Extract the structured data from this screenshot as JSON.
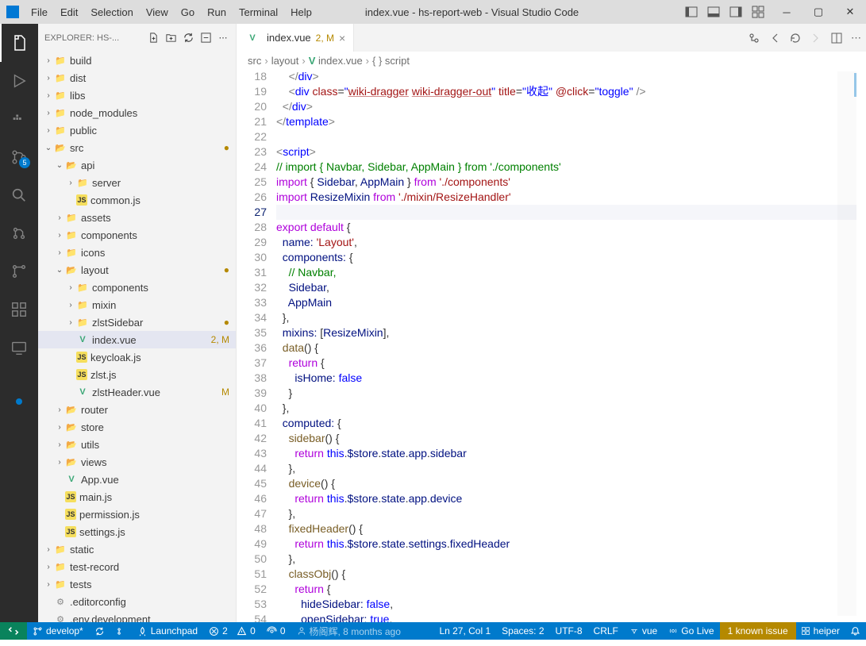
{
  "titlebar": {
    "menu": [
      "File",
      "Edit",
      "Selection",
      "View",
      "Go",
      "Run",
      "Terminal",
      "Help"
    ],
    "title": "index.vue - hs-report-web - Visual Studio Code"
  },
  "sidebar": {
    "header": "EXPLORER: HS-...",
    "tree": [
      {
        "indent": 0,
        "chev": "›",
        "icon": "folder-g",
        "name": "build"
      },
      {
        "indent": 0,
        "chev": "›",
        "icon": "folder-g",
        "name": "dist"
      },
      {
        "indent": 0,
        "chev": "›",
        "icon": "folder-g",
        "name": "libs"
      },
      {
        "indent": 0,
        "chev": "›",
        "icon": "folder-g",
        "name": "node_modules"
      },
      {
        "indent": 0,
        "chev": "›",
        "icon": "folder-g",
        "name": "public"
      },
      {
        "indent": 0,
        "chev": "⌄",
        "icon": "folder-o",
        "name": "src",
        "mod": "●"
      },
      {
        "indent": 1,
        "chev": "⌄",
        "icon": "folder-o",
        "name": "api"
      },
      {
        "indent": 2,
        "chev": "›",
        "icon": "folder-g",
        "name": "server"
      },
      {
        "indent": 2,
        "chev": "",
        "icon": "js",
        "name": "common.js"
      },
      {
        "indent": 1,
        "chev": "›",
        "icon": "folder-g",
        "name": "assets"
      },
      {
        "indent": 1,
        "chev": "›",
        "icon": "folder-g",
        "name": "components"
      },
      {
        "indent": 1,
        "chev": "›",
        "icon": "folder-g",
        "name": "icons"
      },
      {
        "indent": 1,
        "chev": "⌄",
        "icon": "folder-o",
        "name": "layout",
        "mod": "●"
      },
      {
        "indent": 2,
        "chev": "›",
        "icon": "folder-g",
        "name": "components"
      },
      {
        "indent": 2,
        "chev": "›",
        "icon": "folder-g",
        "name": "mixin"
      },
      {
        "indent": 2,
        "chev": "›",
        "icon": "folder-g",
        "name": "zlstSidebar",
        "mod": "●"
      },
      {
        "indent": 2,
        "chev": "",
        "icon": "vue",
        "name": "index.vue",
        "mod": "2, M",
        "selected": true
      },
      {
        "indent": 2,
        "chev": "",
        "icon": "js",
        "name": "keycloak.js"
      },
      {
        "indent": 2,
        "chev": "",
        "icon": "js",
        "name": "zlst.js"
      },
      {
        "indent": 2,
        "chev": "",
        "icon": "vue",
        "name": "zlstHeader.vue",
        "mod": "M"
      },
      {
        "indent": 1,
        "chev": "›",
        "icon": "folder-o",
        "name": "router"
      },
      {
        "indent": 1,
        "chev": "›",
        "icon": "folder-o",
        "name": "store"
      },
      {
        "indent": 1,
        "chev": "›",
        "icon": "folder-o",
        "name": "utils"
      },
      {
        "indent": 1,
        "chev": "›",
        "icon": "folder-o",
        "name": "views"
      },
      {
        "indent": 1,
        "chev": "",
        "icon": "vue",
        "name": "App.vue"
      },
      {
        "indent": 1,
        "chev": "",
        "icon": "js",
        "name": "main.js"
      },
      {
        "indent": 1,
        "chev": "",
        "icon": "js",
        "name": "permission.js"
      },
      {
        "indent": 1,
        "chev": "",
        "icon": "js",
        "name": "settings.js"
      },
      {
        "indent": 0,
        "chev": "›",
        "icon": "folder-g",
        "name": "static"
      },
      {
        "indent": 0,
        "chev": "›",
        "icon": "folder-g",
        "name": "test-record"
      },
      {
        "indent": 0,
        "chev": "›",
        "icon": "folder-g",
        "name": "tests"
      },
      {
        "indent": 0,
        "chev": "",
        "icon": "gear",
        "name": ".editorconfig"
      },
      {
        "indent": 0,
        "chev": "",
        "icon": "gear",
        "name": ".env.development"
      }
    ]
  },
  "tabs": {
    "open": [
      {
        "name": "index.vue",
        "mod": "2, M"
      }
    ]
  },
  "breadcrumb": [
    "src",
    "layout",
    "index.vue",
    "script"
  ],
  "code": {
    "startLine": 18,
    "currentLine": 27
  },
  "statusbar": {
    "branch": "develop*",
    "launchpad": "Launchpad",
    "errors": "2",
    "warnings": "0",
    "ports": "0",
    "blame": "杨阁辉, 8 months ago",
    "position": "Ln 27, Col 1",
    "spaces": "Spaces: 2",
    "encoding": "UTF-8",
    "eol": "CRLF",
    "lang": "vue",
    "golive": "Go Live",
    "issues": "1 known issue",
    "helper": "heiper"
  },
  "badge": {
    "scm": "5"
  }
}
